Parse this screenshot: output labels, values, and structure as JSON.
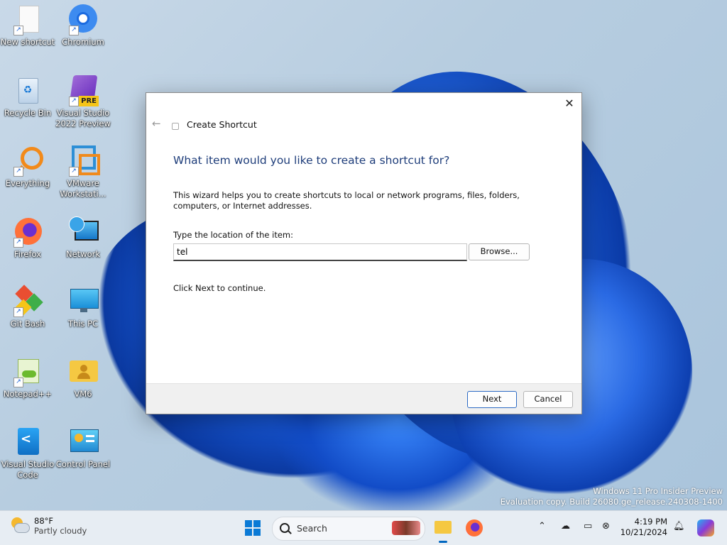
{
  "desktop": {
    "icons": [
      {
        "label": "New shortcut"
      },
      {
        "label": "Chromium"
      },
      {
        "label": "Recycle Bin"
      },
      {
        "label": "Visual Studio 2022 Preview",
        "badge": "PRE"
      },
      {
        "label": "Everything"
      },
      {
        "label": "VMware Workstati..."
      },
      {
        "label": "Firefox"
      },
      {
        "label": "Network"
      },
      {
        "label": "Git Bash"
      },
      {
        "label": "This PC"
      },
      {
        "label": "Notepad++"
      },
      {
        "label": "VM6"
      },
      {
        "label": "Visual Studio Code"
      },
      {
        "label": "Control Panel"
      }
    ]
  },
  "dialog": {
    "title": "Create Shortcut",
    "close_glyph": "✕",
    "back_glyph": "←",
    "heading": "What item would you like to create a shortcut for?",
    "description": "This wizard helps you to create shortcuts to local or network programs, files, folders, computers, or Internet addresses.",
    "location_label": "Type the location of the item:",
    "location_value": "tel",
    "browse_label": "Browse...",
    "continue_text": "Click Next to continue.",
    "next_label": "Next",
    "cancel_label": "Cancel"
  },
  "watermark": {
    "line1": "Windows 11 Pro Insider Preview",
    "line2": "Evaluation copy. Build 26080.ge_release.240308-1400"
  },
  "taskbar": {
    "weather_temp": "88°F",
    "weather_condition": "Partly cloudy",
    "search_label": "Search",
    "time": "4:19 PM",
    "date": "10/21/2024",
    "accent_color": "#0067c0"
  }
}
